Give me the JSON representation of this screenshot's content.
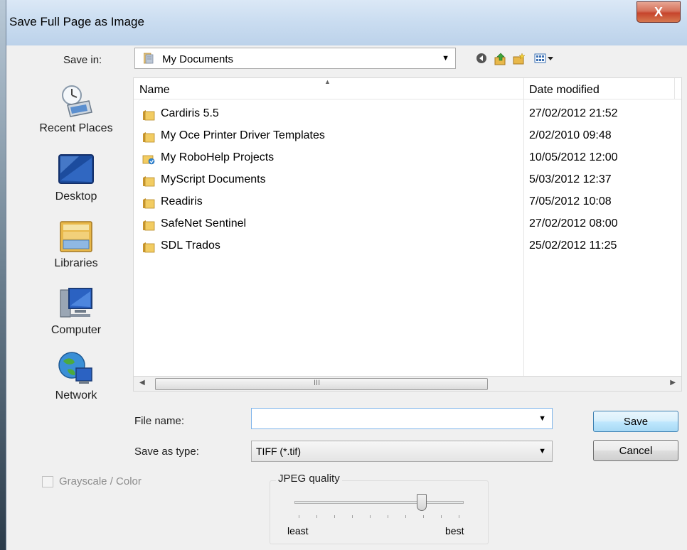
{
  "window": {
    "title": "Save Full Page as Image",
    "close_label": "X"
  },
  "toolbar": {
    "save_in_label": "Save in:",
    "save_in_value": "My Documents",
    "icons": [
      "back-icon",
      "up-folder-icon",
      "new-folder-icon",
      "view-menu-icon"
    ]
  },
  "places": [
    {
      "label": "Recent Places",
      "icon": "recent-places-icon"
    },
    {
      "label": "Desktop",
      "icon": "desktop-icon"
    },
    {
      "label": "Libraries",
      "icon": "libraries-icon"
    },
    {
      "label": "Computer",
      "icon": "computer-icon"
    },
    {
      "label": "Network",
      "icon": "network-icon"
    }
  ],
  "file_list": {
    "columns": {
      "name": "Name",
      "date": "Date modified"
    },
    "rows": [
      {
        "name": "Cardiris 5.5",
        "date": "27/02/2012 21:52",
        "icon": "folder-icon"
      },
      {
        "name": "My Oce Printer Driver Templates",
        "date": "2/02/2010 09:48",
        "icon": "folder-icon"
      },
      {
        "name": "My RoboHelp Projects",
        "date": "10/05/2012 12:00",
        "icon": "special-folder-icon"
      },
      {
        "name": "MyScript Documents",
        "date": "5/03/2012 12:37",
        "icon": "folder-icon"
      },
      {
        "name": "Readiris",
        "date": "7/05/2012 10:08",
        "icon": "folder-icon"
      },
      {
        "name": "SafeNet Sentinel",
        "date": "27/02/2012 08:00",
        "icon": "folder-icon"
      },
      {
        "name": "SDL Trados",
        "date": "25/02/2012 11:25",
        "icon": "folder-icon"
      }
    ],
    "scrollbar_grip": "III"
  },
  "form": {
    "file_name_label": "File name:",
    "file_name_value": "",
    "save_as_type_label": "Save as type:",
    "save_as_type_value": "TIFF (*.tif)"
  },
  "buttons": {
    "save": "Save",
    "cancel": "Cancel"
  },
  "options": {
    "grayscale_label": "Grayscale / Color",
    "grayscale_checked": false,
    "grayscale_enabled": false,
    "jpeg_quality_label": "JPEG quality",
    "slider_min_label": "least",
    "slider_max_label": "best",
    "slider_value_fraction": 0.75
  },
  "colors": {
    "title_bar": "#c9dcf0",
    "close_button": "#c6442c",
    "default_button_border": "#3c7fb1",
    "folder_yellow": "#e8b84a",
    "window_bg": "#f0f0f0"
  }
}
